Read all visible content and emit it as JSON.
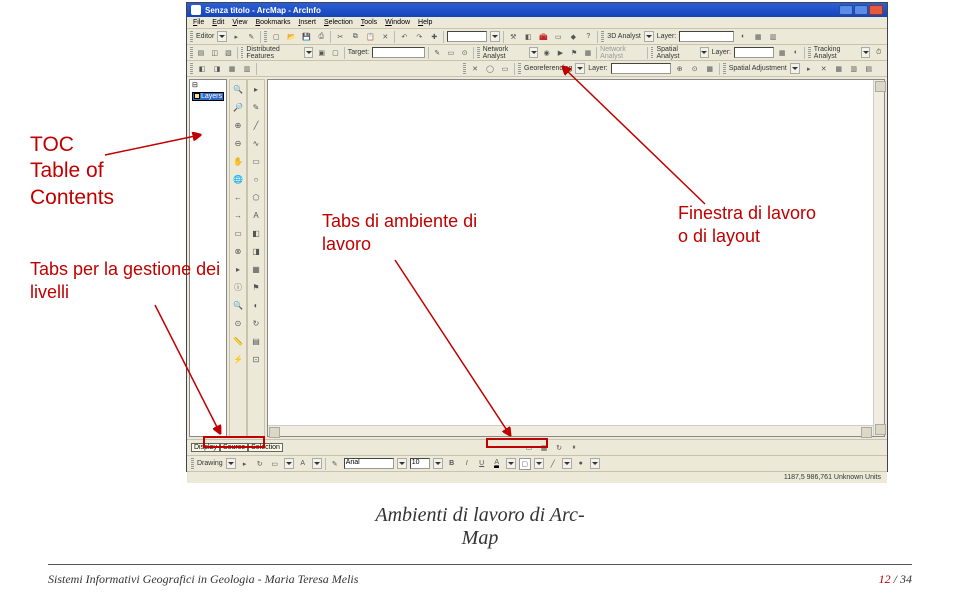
{
  "annotations": {
    "toc": "TOC\nTable of\nContents",
    "tabs_gestione": "Tabs per la gestione dei\nlivelli",
    "tabs_ambiente": "Tabs di ambiente di\nlavoro",
    "finestra": "Finestra di lavoro\no di layout"
  },
  "caption_line1": "Ambienti di lavoro di Arc-",
  "caption_line2": "Map",
  "footer": {
    "left": "Sistemi Informativi Geografici in Geologia - Maria Teresa Melis",
    "page": "12",
    "total": "34"
  },
  "window": {
    "title": "Senza titolo - ArcMap - ArcInfo",
    "menus": [
      "File",
      "Edit",
      "View",
      "Bookmarks",
      "Insert",
      "Selection",
      "Tools",
      "Window",
      "Help"
    ],
    "toolbars": {
      "row1": {
        "editor_label": "Editor",
        "analyst_3d": "3D Analyst",
        "layer_label": "Layer:"
      },
      "row2": {
        "distributed": "Distributed Features",
        "target_label": "Target:",
        "network": "Network Analyst",
        "network2": "Network Analyst",
        "spatial": "Spatial Analyst",
        "layer_label": "Layer:",
        "tracking": "Tracking Analyst"
      },
      "row3": {
        "georef": "Georeferencing",
        "layer_label": "Layer:",
        "spatial_adj": "Spatial Adjustment"
      }
    },
    "toc_label": "Layers",
    "bottom": {
      "tabs": [
        "Display",
        "Source",
        "Selection"
      ],
      "drawing_label": "Drawing",
      "font": "Arial",
      "size": "10"
    },
    "status": "1187,5  986,761 Unknown Units"
  }
}
